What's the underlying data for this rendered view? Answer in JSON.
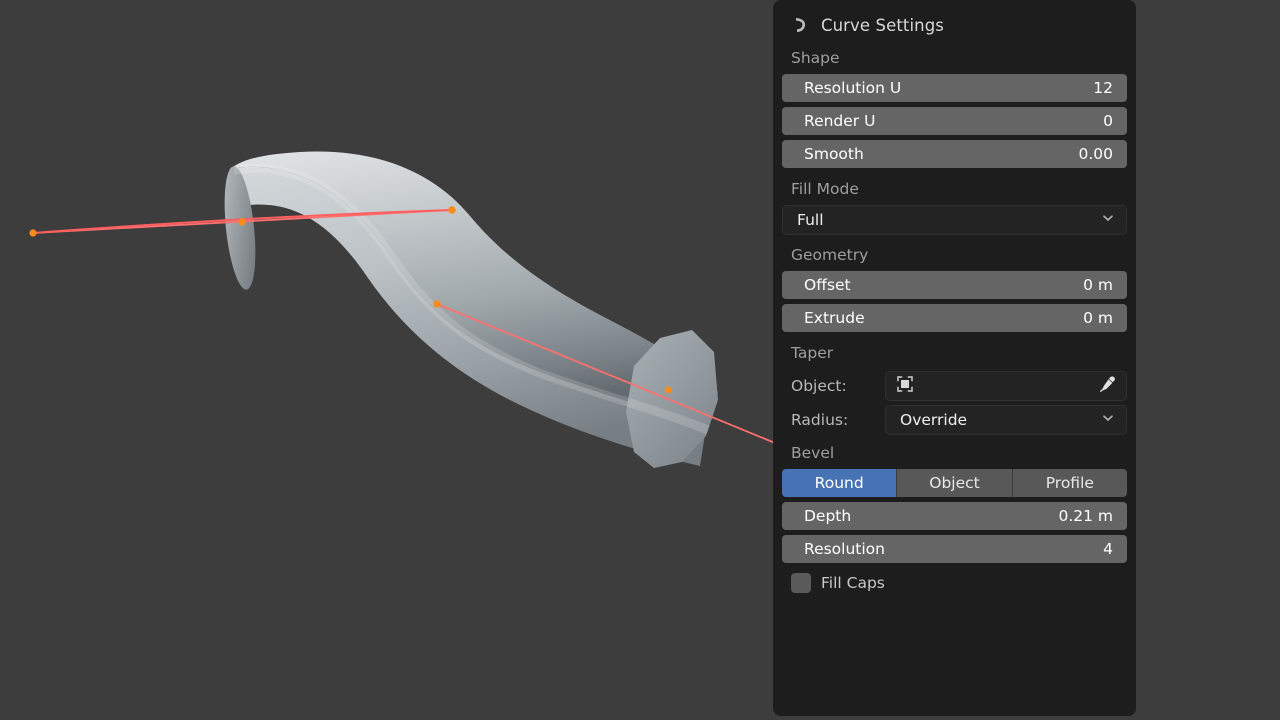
{
  "viewport": {
    "name": "3d-viewport",
    "background_color": "#3d3d3d",
    "object_description": "Bezier curve with round bevel rendered as a bent tube",
    "surface_color_light": "#c3c8cb",
    "surface_color_dark": "#6e7579",
    "curve_line_color": "#ff5f5f",
    "control_point_color": "#ff8c1a",
    "handle_line_color": "#ff7070"
  },
  "panel": {
    "header": {
      "icon": "curve-bezier-icon",
      "title": "Curve Settings"
    },
    "shape": {
      "label": "Shape",
      "fields": [
        {
          "label": "Resolution U",
          "value": "12"
        },
        {
          "label": "Render  U",
          "value": "0"
        },
        {
          "label": "Smooth",
          "value": "0.00"
        }
      ]
    },
    "fill_mode": {
      "label": "Fill Mode",
      "value": "Full",
      "chevron": "chevron-down-icon"
    },
    "geometry": {
      "label": "Geometry",
      "fields": [
        {
          "label": "Offset",
          "value": "0 m"
        },
        {
          "label": "Extrude",
          "value": "0 m"
        }
      ]
    },
    "taper": {
      "label": "Taper",
      "object": {
        "label": "Object:",
        "value": "",
        "icon": "object-placeholder-icon",
        "picker_icon": "eyedropper-icon"
      },
      "radius": {
        "label": "Radius:",
        "value": "Override",
        "chevron": "chevron-down-icon"
      }
    },
    "bevel": {
      "label": "Bevel",
      "tabs": [
        {
          "label": "Round",
          "active": true
        },
        {
          "label": "Object",
          "active": false
        },
        {
          "label": "Profile",
          "active": false
        }
      ],
      "active_color": "#4772b3",
      "fields": [
        {
          "label": "Depth",
          "value": "0.21 m"
        },
        {
          "label": "Resolution",
          "value": "4"
        }
      ],
      "fill_caps": {
        "label": "Fill Caps",
        "checked": false
      }
    }
  }
}
